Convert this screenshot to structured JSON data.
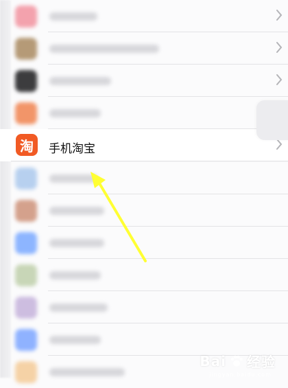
{
  "focused_item": {
    "label": "手机淘宝",
    "icon_glyph": "淘",
    "icon_color": "#f15a24"
  },
  "blurred_rows": [
    {
      "icon_color": "#f3a2ad"
    },
    {
      "icon_color": "#b59a77"
    },
    {
      "icon_color": "#3c3c3e"
    },
    {
      "icon_color": "#f29569"
    },
    {
      "icon_color": "#b7d0ef"
    },
    {
      "icon_color": "#d4a18c"
    },
    {
      "icon_color": "#8db5ff"
    },
    {
      "icon_color": "#c8d6b7"
    },
    {
      "icon_color": "#cdbde0"
    },
    {
      "icon_color": "#8fb2ff"
    },
    {
      "icon_color": "#f5d2a6"
    }
  ],
  "annotation": {
    "arrow_color": "#ffff33"
  },
  "watermark": {
    "brand": "Bai",
    "brand_tail": "经验",
    "sub": "jingyan.baidu.com"
  }
}
